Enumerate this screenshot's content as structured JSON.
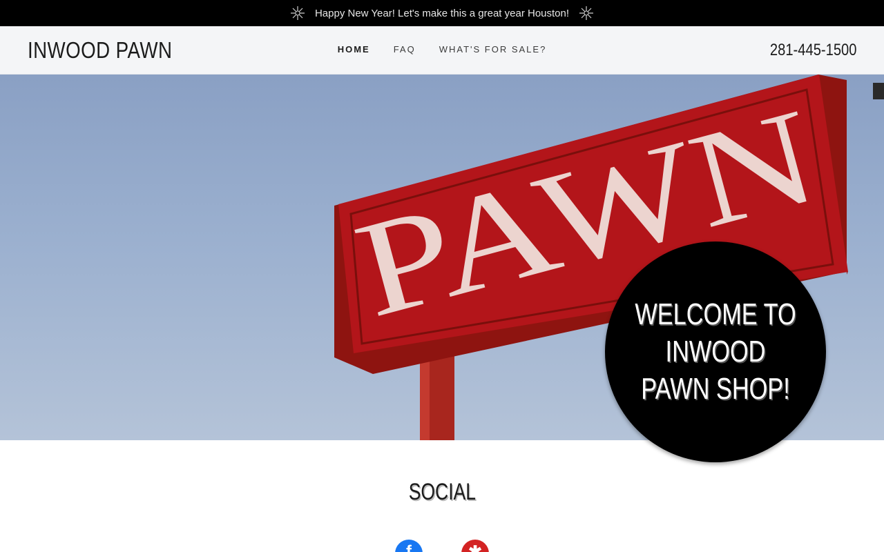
{
  "announcement": {
    "text": "Happy New Year! Let's make this a great year Houston!",
    "icon": "fireworks-icon"
  },
  "header": {
    "brand": "INWOOD PAWN",
    "nav": [
      {
        "label": "HOME",
        "active": true
      },
      {
        "label": "FAQ",
        "active": false
      },
      {
        "label": "WHAT'S FOR SALE?",
        "active": false
      }
    ],
    "phone": "281-445-1500"
  },
  "hero": {
    "sign_text": "PAWN",
    "welcome": "WELCOME TO\nINWOOD\nPAWN SHOP!"
  },
  "social": {
    "title": "SOCIAL",
    "icons": [
      "facebook-icon",
      "yelp-icon"
    ]
  },
  "colors": {
    "sign_red": "#b3151a",
    "facebook": "#1877f2",
    "yelp": "#d32323",
    "topbar": "#000000"
  }
}
